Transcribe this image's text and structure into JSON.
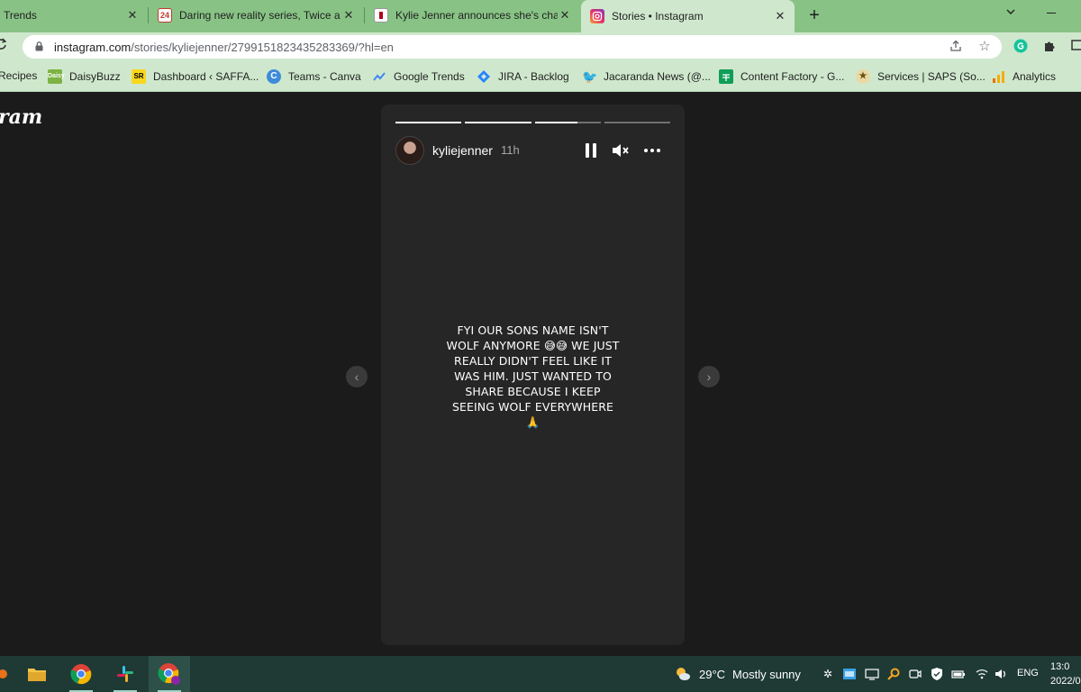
{
  "browser": {
    "tabs": [
      {
        "title": "Trends",
        "favicon": "google-trends-icon",
        "active": false
      },
      {
        "title": "Daring new reality series, Twice a",
        "favicon": "calendar-24-icon",
        "active": false
      },
      {
        "title": "Kylie Jenner announces she's cha",
        "favicon": "news-site-icon",
        "active": false
      },
      {
        "title": "Stories • Instagram",
        "favicon": "instagram-icon",
        "active": true
      }
    ],
    "new_tab_symbol": "+",
    "url_host": "instagram.com",
    "url_path": "/stories/kyliejenner/2799151823435283369/?hl=en",
    "bookmarks": [
      {
        "label": "Recipes",
        "icon": "recipes-icon",
        "color": "#8d6e63"
      },
      {
        "label": "DaisyBuzz",
        "icon": "daisybuzz-icon",
        "color": "#7cb342"
      },
      {
        "label": "Dashboard ‹ SAFFA...",
        "icon": "sr-icon",
        "color": "#f9d71c"
      },
      {
        "label": "Teams - Canva",
        "icon": "canva-icon",
        "color": "#3d8bd9"
      },
      {
        "label": "Google Trends",
        "icon": "trends-icon",
        "color": "#4285f4"
      },
      {
        "label": "JIRA - Backlog",
        "icon": "jira-icon",
        "color": "#2684ff"
      },
      {
        "label": "Jacaranda News (@...",
        "icon": "twitter-icon",
        "color": "#1d9bf0"
      },
      {
        "label": "Content Factory - G...",
        "icon": "sheets-icon",
        "color": "#0f9d58"
      },
      {
        "label": "Services | SAPS (So...",
        "icon": "saps-icon",
        "color": "#b08d2e"
      },
      {
        "label": "Analytics",
        "icon": "analytics-icon",
        "color": "#f9ab00"
      }
    ]
  },
  "instagram": {
    "logo_text": "ram",
    "story": {
      "username": "kyliejenner",
      "time": "11h",
      "progress": [
        1.0,
        1.0,
        0.65,
        0.0
      ],
      "text": "FYI OUR SONS NAME ISN'T WOLF ANYMORE 😅😅 WE JUST REALLY DIDN'T FEEL LIKE IT WAS HIM. JUST WANTED TO SHARE BECAUSE I KEEP SEEING WOLF EVERYWHERE 🙏",
      "prev_symbol": "‹",
      "next_symbol": "›"
    }
  },
  "taskbar": {
    "apps": [
      {
        "name": "file-explorer-icon",
        "active": false
      },
      {
        "name": "chrome-icon",
        "active": false
      },
      {
        "name": "slack-icon",
        "active": false
      },
      {
        "name": "chrome-profile-icon",
        "active": true
      }
    ],
    "weather_temp": "29°C",
    "weather_desc": "Mostly sunny",
    "language": "ENG",
    "time": "13:0",
    "date": "2022/0"
  }
}
